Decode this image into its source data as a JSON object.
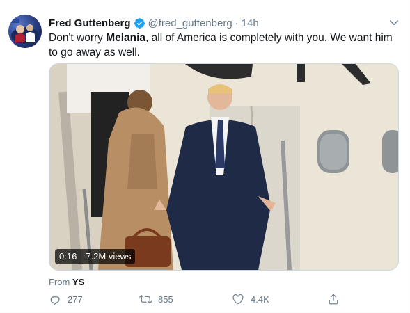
{
  "tweet": {
    "display_name": "Fred Guttenberg",
    "handle": "@fred_guttenberg",
    "separator": "·",
    "timestamp": "14h",
    "verified": true,
    "text_before": "Don't worry ",
    "text_bold": "Melania",
    "text_after": ", all of America is completely with you.  We want him to go away as well.",
    "media": {
      "type": "video",
      "duration": "0:16",
      "views": "7.2M views"
    },
    "source_prefix": "From",
    "source_name": "YS"
  },
  "actions": {
    "reply_count": "277",
    "retweet_count": "855",
    "like_count": "4.4K"
  },
  "colors": {
    "accent": "#1da1f2",
    "secondary_text": "#657786",
    "primary_text": "#14171a",
    "border": "#e6ecf0"
  },
  "icons": [
    "verified-badge-icon",
    "chevron-down-icon",
    "reply-icon",
    "retweet-icon",
    "like-icon",
    "share-icon"
  ]
}
